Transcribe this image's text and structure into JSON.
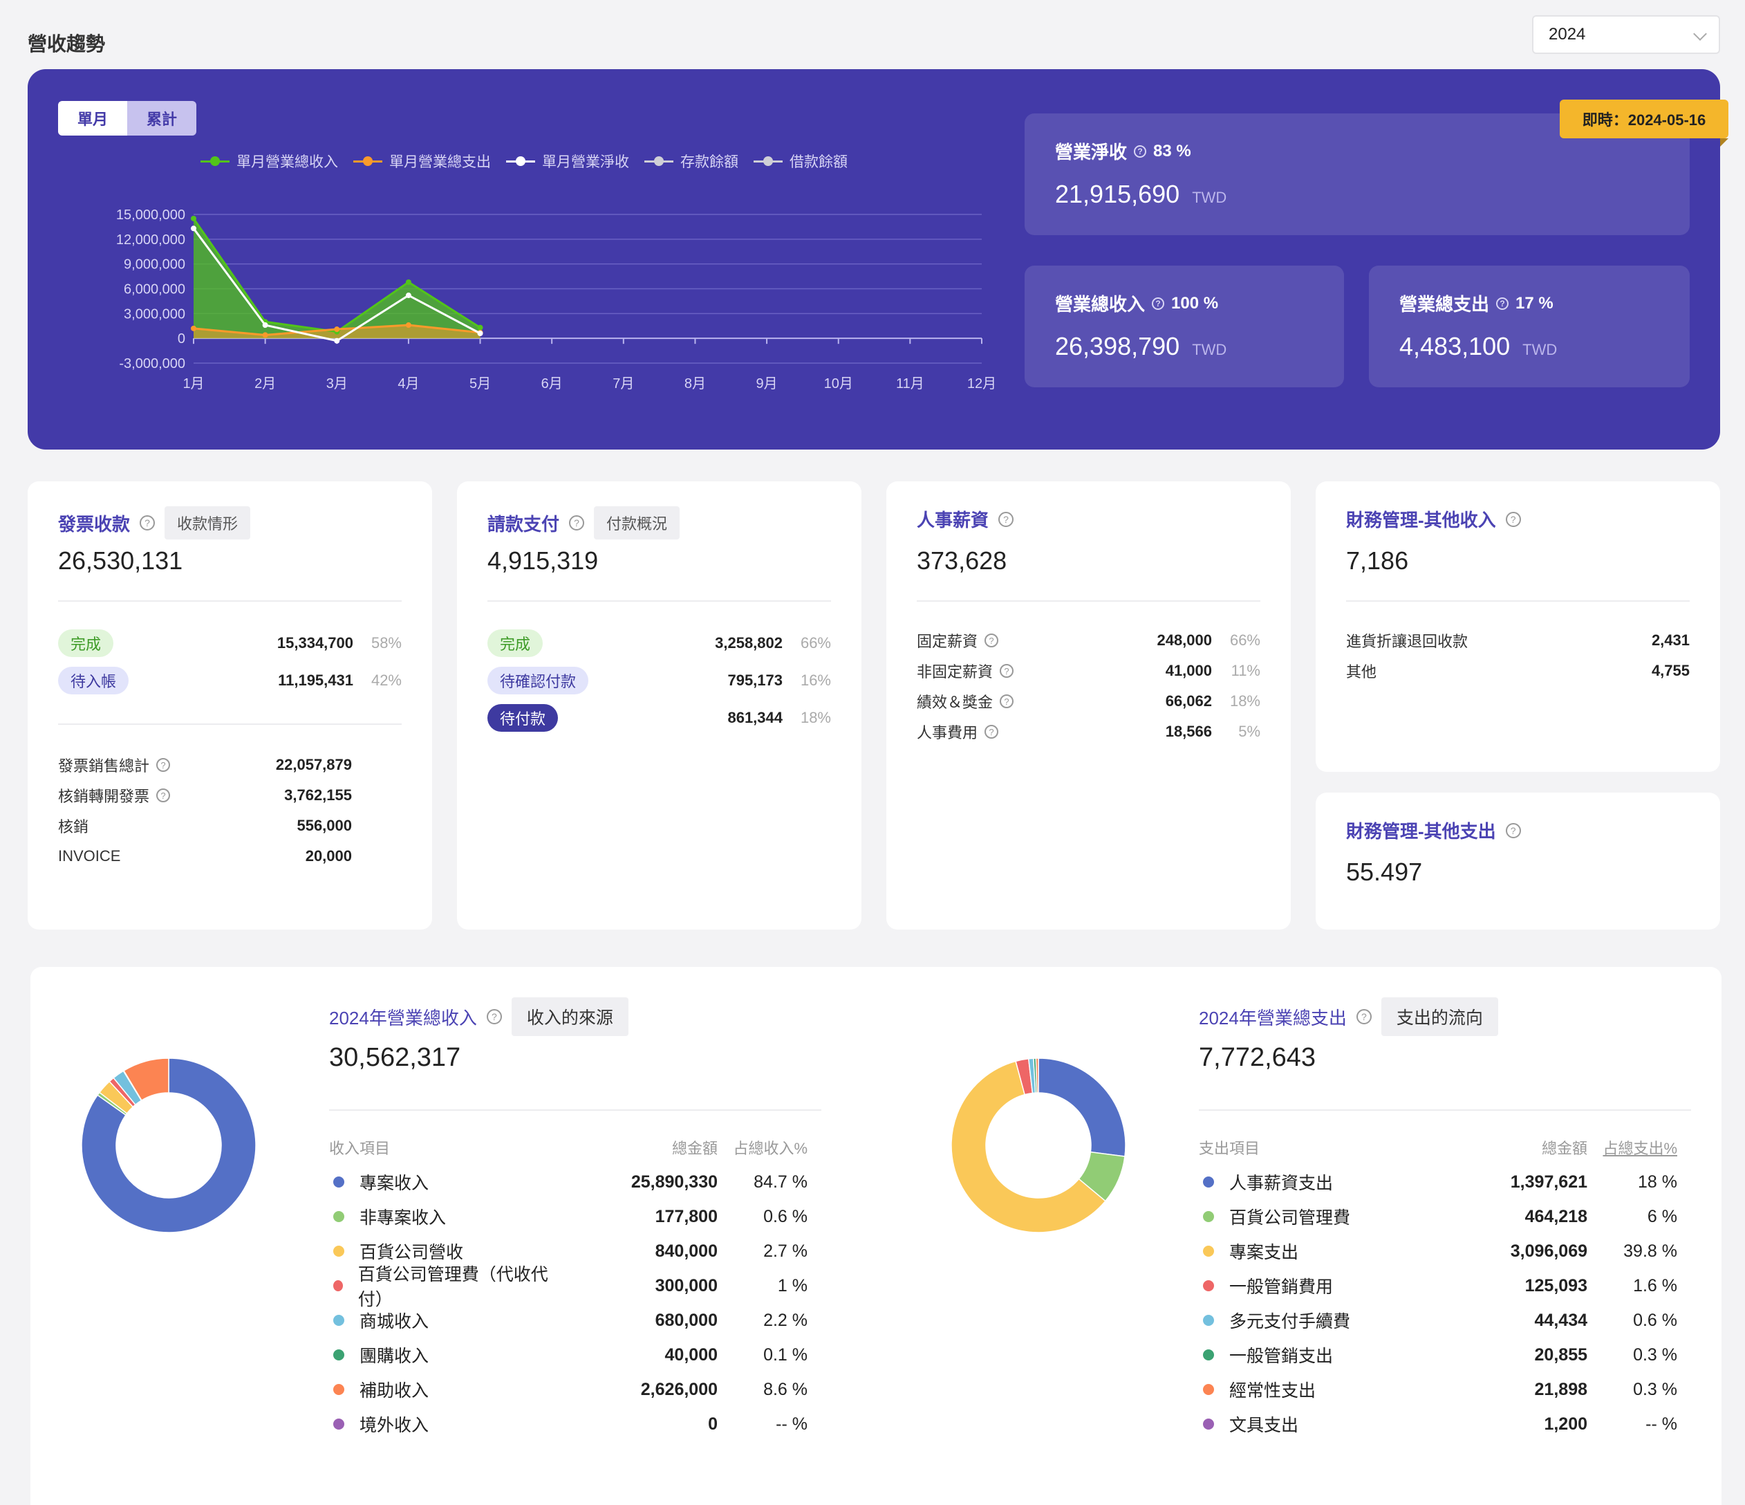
{
  "page": {
    "title": "營收趨勢",
    "year": "2024"
  },
  "hero": {
    "toggle": {
      "monthly": "單月",
      "cumulative": "累計"
    },
    "legend": [
      {
        "label": "單月營業總收入",
        "color": "#52c41a"
      },
      {
        "label": "單月營業總支出",
        "color": "#fa9a2b"
      },
      {
        "label": "單月營業淨收",
        "color": "#ffffff"
      },
      {
        "label": "存款餘額",
        "color": "#cfcfd6"
      },
      {
        "label": "借款餘額",
        "color": "#cfcfd6"
      }
    ],
    "realtime": "即時：2024-05-16",
    "net": {
      "label": "營業淨收",
      "pct": "83 %",
      "value": "21,915,690",
      "unit": "TWD"
    },
    "income": {
      "label": "營業總收入",
      "pct": "100 %",
      "value": "26,398,790",
      "unit": "TWD"
    },
    "expense": {
      "label": "營業總支出",
      "pct": "17 %",
      "value": "4,483,100",
      "unit": "TWD"
    }
  },
  "chart_data": {
    "type": "line",
    "categories": [
      "1月",
      "2月",
      "3月",
      "4月",
      "5月",
      "6月",
      "7月",
      "8月",
      "9月",
      "10月",
      "11月",
      "12月"
    ],
    "y_ticks": [
      "15,000,000",
      "12,000,000",
      "9,000,000",
      "6,000,000",
      "3,000,000",
      "0",
      "-3,000,000"
    ],
    "ylim": [
      -3000000,
      15000000
    ],
    "series": [
      {
        "name": "單月營業總收入",
        "color": "#52c41a",
        "values": [
          14500000,
          2000000,
          800000,
          6800000,
          1300000
        ]
      },
      {
        "name": "單月營業總支出",
        "color": "#fa9a2b",
        "values": [
          1200000,
          400000,
          1100000,
          1600000,
          700000
        ]
      },
      {
        "name": "單月營業淨收",
        "color": "#ffffff",
        "values": [
          13300000,
          1600000,
          -300000,
          5200000,
          600000
        ]
      }
    ]
  },
  "invoice": {
    "title": "發票收款",
    "tag": "收款情形",
    "total": "26,530,131",
    "status": [
      {
        "label": "完成",
        "value": "15,334,700",
        "pct": "58%"
      },
      {
        "label": "待入帳",
        "value": "11,195,431",
        "pct": "42%"
      }
    ],
    "details": [
      {
        "label": "發票銷售總計",
        "value": "22,057,879",
        "help": true
      },
      {
        "label": "核銷轉開發票",
        "value": "3,762,155",
        "help": true
      },
      {
        "label": "核銷",
        "value": "556,000",
        "help": false
      },
      {
        "label": "INVOICE",
        "value": "20,000",
        "help": false
      }
    ]
  },
  "payment": {
    "title": "請款支付",
    "tag": "付款概況",
    "total": "4,915,319",
    "status": [
      {
        "label": "完成",
        "value": "3,258,802",
        "pct": "66%"
      },
      {
        "label": "待確認付款",
        "value": "795,173",
        "pct": "16%"
      },
      {
        "label": "待付款",
        "value": "861,344",
        "pct": "18%"
      }
    ]
  },
  "salary": {
    "title": "人事薪資",
    "total": "373,628",
    "items": [
      {
        "label": "固定薪資",
        "value": "248,000",
        "pct": "66%"
      },
      {
        "label": "非固定薪資",
        "value": "41,000",
        "pct": "11%"
      },
      {
        "label": "績效＆獎金",
        "value": "66,062",
        "pct": "18%"
      },
      {
        "label": "人事費用",
        "value": "18,566",
        "pct": "5%"
      }
    ]
  },
  "other_income": {
    "title": "財務管理-其他收入",
    "total": "7,186",
    "items": [
      {
        "label": "進貨折讓退回收款",
        "value": "2,431"
      },
      {
        "label": "其他",
        "value": "4,755"
      }
    ]
  },
  "other_expense": {
    "title": "財務管理-其他支出",
    "total": "55.497"
  },
  "income_breakdown": {
    "title": "2024年營業總收入",
    "tag": "收入的來源",
    "total": "30,562,317",
    "headers": {
      "item": "收入項目",
      "amount": "總金額",
      "pct": "占總收入%"
    },
    "rows": [
      {
        "label": "專案收入",
        "value": "25,890,330",
        "pct": "84.7 %",
        "share": 84.7,
        "color": "#5470c6"
      },
      {
        "label": "非專案收入",
        "value": "177,800",
        "pct": "0.6 %",
        "share": 0.6,
        "color": "#91cc75"
      },
      {
        "label": "百貨公司營收",
        "value": "840,000",
        "pct": "2.7 %",
        "share": 2.7,
        "color": "#fac858"
      },
      {
        "label": "百貨公司管理費（代收代付）",
        "value": "300,000",
        "pct": "1 %",
        "share": 1.0,
        "color": "#ee6666"
      },
      {
        "label": "商城收入",
        "value": "680,000",
        "pct": "2.2 %",
        "share": 2.2,
        "color": "#73c0de"
      },
      {
        "label": "團購收入",
        "value": "40,000",
        "pct": "0.1 %",
        "share": 0.1,
        "color": "#3ba272"
      },
      {
        "label": "補助收入",
        "value": "2,626,000",
        "pct": "8.6 %",
        "share": 8.6,
        "color": "#fc8452"
      },
      {
        "label": "境外收入",
        "value": "0",
        "pct": "-- %",
        "share": 0,
        "color": "#9a60b4"
      }
    ]
  },
  "expense_breakdown": {
    "title": "2024年營業總支出",
    "tag": "支出的流向",
    "total": "7,772,643",
    "headers": {
      "item": "支出項目",
      "amount": "總金額",
      "pct": "占總支出%"
    },
    "rows": [
      {
        "label": "人事薪資支出",
        "value": "1,397,621",
        "pct": "18 %",
        "share": 18,
        "color": "#5470c6"
      },
      {
        "label": "百貨公司管理費",
        "value": "464,218",
        "pct": "6 %",
        "share": 6,
        "color": "#91cc75"
      },
      {
        "label": "專案支出",
        "value": "3,096,069",
        "pct": "39.8 %",
        "share": 39.8,
        "color": "#fac858"
      },
      {
        "label": "一般管銷費用",
        "value": "125,093",
        "pct": "1.6 %",
        "share": 1.6,
        "color": "#ee6666"
      },
      {
        "label": "多元支付手續費",
        "value": "44,434",
        "pct": "0.6 %",
        "share": 0.6,
        "color": "#73c0de"
      },
      {
        "label": "一般管銷支出",
        "value": "20,855",
        "pct": "0.3 %",
        "share": 0.3,
        "color": "#3ba272"
      },
      {
        "label": "經常性支出",
        "value": "21,898",
        "pct": "0.3 %",
        "share": 0.3,
        "color": "#fc8452"
      },
      {
        "label": "文具支出",
        "value": "1,200",
        "pct": "-- %",
        "share": 0,
        "color": "#9a60b4"
      }
    ]
  }
}
